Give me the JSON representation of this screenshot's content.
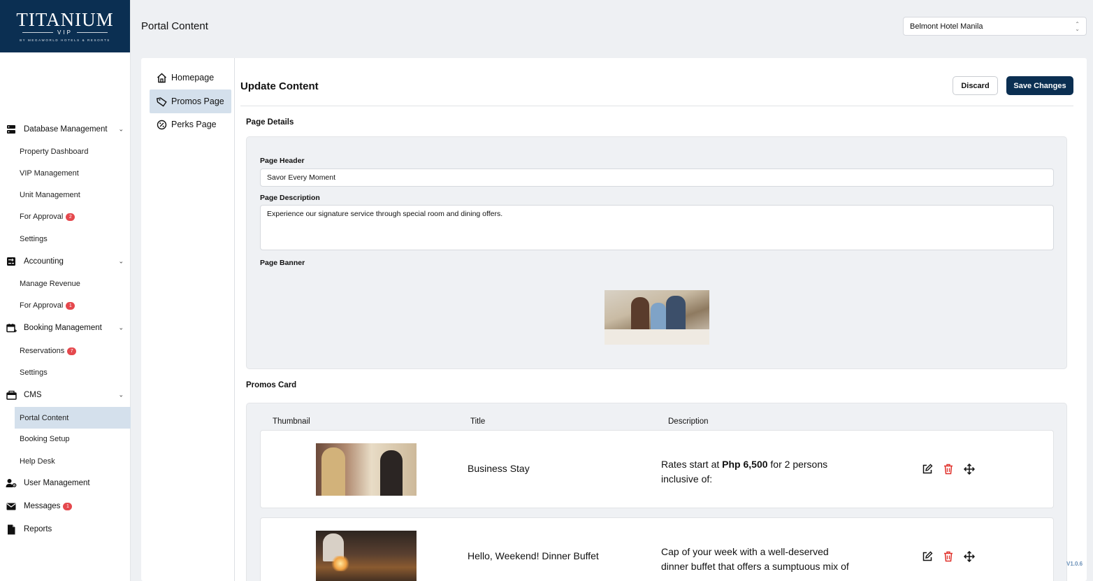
{
  "brand": {
    "name": "TITANIUM",
    "tier": "VIP",
    "tagline": "BY MEGAWORLD HOTELS & RESORTS"
  },
  "sidebar": {
    "groups": [
      {
        "label": "Database Management",
        "icon": "database-icon",
        "items": [
          {
            "label": "Property Dashboard"
          },
          {
            "label": "VIP Management"
          },
          {
            "label": "Unit Management"
          },
          {
            "label": "For Approval",
            "badge": "2"
          },
          {
            "label": "Settings"
          }
        ]
      },
      {
        "label": "Accounting",
        "icon": "accounting-icon",
        "items": [
          {
            "label": "Manage Revenue"
          },
          {
            "label": "For Approval",
            "badge": "1"
          }
        ]
      },
      {
        "label": "Booking Management",
        "icon": "calendar-plus-icon",
        "items": [
          {
            "label": "Reservations",
            "badge": "7"
          },
          {
            "label": "Settings"
          }
        ]
      },
      {
        "label": "CMS",
        "icon": "cms-icon",
        "items": [
          {
            "label": "Portal Content",
            "active": true
          },
          {
            "label": "Booking Setup"
          },
          {
            "label": "Help Desk"
          }
        ]
      }
    ],
    "user_management": "User Management",
    "messages": {
      "label": "Messages",
      "badge": "1"
    },
    "reports": "Reports"
  },
  "header": {
    "title": "Portal Content",
    "property": "Belmont Hotel Manila"
  },
  "sub_nav": [
    {
      "label": "Homepage",
      "icon": "home-icon"
    },
    {
      "label": "Promos Page",
      "icon": "tag-icon",
      "active": true
    },
    {
      "label": "Perks Page",
      "icon": "discount-badge-icon"
    }
  ],
  "main": {
    "title": "Update Content",
    "discard": "Discard",
    "save": "Save Changes",
    "page_details": {
      "section": "Page Details",
      "header_label": "Page Header",
      "header_value": "Savor Every Moment",
      "description_label": "Page Description",
      "description_value": "Experience our signature service through special room and dining offers.",
      "banner_label": "Page Banner"
    },
    "promos": {
      "section": "Promos Card",
      "columns": [
        "Thumbnail",
        "Title",
        "Description"
      ],
      "rows": [
        {
          "title": "Business Stay",
          "desc_pre": "Rates start at ",
          "desc_bold": "Php 6,500",
          "desc_post": " for 2 persons inclusive of:"
        },
        {
          "title": "Hello, Weekend! Dinner Buffet",
          "desc_pre": "Cap of your week with a well-deserved dinner buffet that offers a sumptuous mix of",
          "desc_bold": "",
          "desc_post": ""
        }
      ]
    }
  },
  "version": "V1.0.6",
  "colors": {
    "brand_navy": "#0b2f52",
    "active_bg": "#d4e0ec",
    "badge_red": "#e5484d",
    "delete_red": "#e0302a"
  }
}
